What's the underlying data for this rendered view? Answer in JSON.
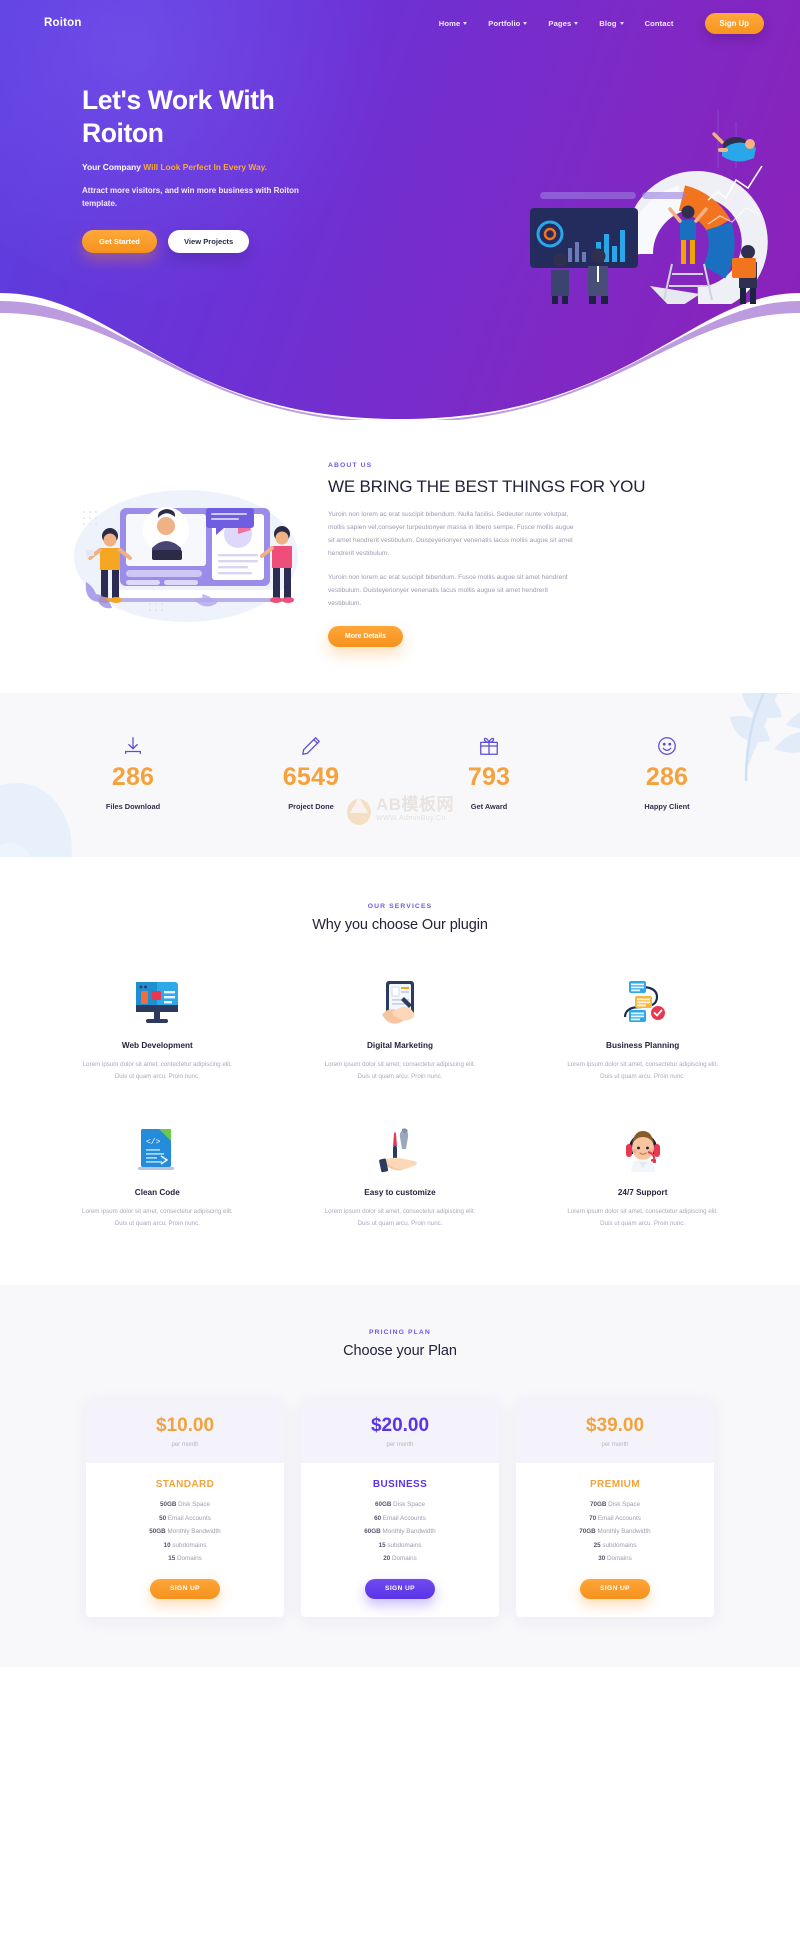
{
  "brand": "Roiton",
  "nav": {
    "items": [
      {
        "label": "Home",
        "caret": true
      },
      {
        "label": "Portfolio",
        "caret": true
      },
      {
        "label": "Pages",
        "caret": true
      },
      {
        "label": "Blog",
        "caret": true
      },
      {
        "label": "Contact",
        "caret": false
      }
    ],
    "signup_label": "Sign Up"
  },
  "hero": {
    "title_line1": "Let's Work With",
    "title_line2": "Roiton",
    "sub_white": "Your Company",
    "sub_accent": "Will Look Perfect In Every Way.",
    "description": "Attract more visitors, and win more business with Roiton template.",
    "btn_primary": "Get Started",
    "btn_secondary": "View Projects"
  },
  "about": {
    "eyebrow": "ABOUT US",
    "title": "WE BRING THE BEST THINGS FOR YOU",
    "paragraph1": "Yuroin non lorem ac erat suscipit bibendum. Nulla facilisi. Sedeuter nunte volutpat, mollis sapien vel,conseyer turpeutionyer massa in libero sempe. Fusce mollis augue sit amet hendrerit vestibulum. Duisteyerionyer venenatis lacus mollis augue sit amet hendrerit vestibulum.",
    "paragraph2": "Yuroin non lorem ac erat suscipit bibendum. Fusce mollis augue sit amet hendrent vestibulum. Duisteyerionyer venenatis lacus mollis augue sit amet hendrerit vestibulum.",
    "button": "More Details"
  },
  "counters": {
    "items": [
      {
        "icon": "download-icon",
        "value": "286",
        "label": "Files Download"
      },
      {
        "icon": "pencil-icon",
        "value": "6549",
        "label": "Project Done"
      },
      {
        "icon": "gift-icon",
        "value": "793",
        "label": "Get Award"
      },
      {
        "icon": "smile-icon",
        "value": "286",
        "label": "Happy Client"
      }
    ]
  },
  "watermark": {
    "main": "AB模板网",
    "sub": "WWW.AdminBuy.Cn"
  },
  "services": {
    "eyebrow": "OUR SERVICES",
    "title": "Why you choose Our plugin",
    "items": [
      {
        "icon": "monitor-icon",
        "name": "Web Development",
        "desc": "Lorem ipsum dolor sit amet, contectetur adipiscing elit. Duis ut quam arcu. Proin nunc."
      },
      {
        "icon": "tablet-hand-icon",
        "name": "Digital Marketing",
        "desc": "Lorem ipsum dolor sit amet, consectetur adipiscing elit. Duis ut quam arcu. Proin nunc."
      },
      {
        "icon": "flowchart-icon",
        "name": "Business Planning",
        "desc": "Lorem ipsum dolor sit amet, consectetur adipiscing elit. Duis ut quam arcu. Proin nunc."
      },
      {
        "icon": "code-file-icon",
        "name": "Clean Code",
        "desc": "Lorem ipsum dolor sit amet, consectetur adipiscing elit. Duis ut quam arcu. Proin nunc."
      },
      {
        "icon": "tools-hand-icon",
        "name": "Easy to customize",
        "desc": "Lorem ipsum dolor sit amet, consectetur adipiscing elit. Duis ut quam arcu. Proin nunc."
      },
      {
        "icon": "support-agent-icon",
        "name": "24/7 Support",
        "desc": "Lorem ipsum dolor sit amet, consectetur adipiscing elit. Duis ut quam arcu. Proin nunc."
      }
    ]
  },
  "pricing": {
    "eyebrow": "PRICING PLAN",
    "title": "Choose your Plan",
    "plans": [
      {
        "amount": "$10.00",
        "period": "per month",
        "name": "STANDARD",
        "accent": "#f2a33c",
        "button": "SIGN UP",
        "button_style": "orange",
        "features": [
          {
            "strong": "50GB",
            "text": " Disk Space"
          },
          {
            "strong": "50",
            "text": " Email Accounts"
          },
          {
            "strong": "50GB",
            "text": " Monthly Bandwidth"
          },
          {
            "strong": "10",
            "text": " subdomains"
          },
          {
            "strong": "15",
            "text": " Domains"
          }
        ]
      },
      {
        "amount": "$20.00",
        "period": "per month",
        "name": "BUSINESS",
        "accent": "#5a33e6",
        "button": "SIGN UP",
        "button_style": "purple",
        "features": [
          {
            "strong": "60GB",
            "text": " Disk Space"
          },
          {
            "strong": "60",
            "text": " Email Accounts"
          },
          {
            "strong": "60GB",
            "text": " Monthly Bandwidth"
          },
          {
            "strong": "15",
            "text": " subdomains"
          },
          {
            "strong": "20",
            "text": " Domains"
          }
        ]
      },
      {
        "amount": "$39.00",
        "period": "per month",
        "name": "PREMIUM",
        "accent": "#f2a33c",
        "button": "SIGN UP",
        "button_style": "orange",
        "features": [
          {
            "strong": "70GB",
            "text": " Disk Space"
          },
          {
            "strong": "70",
            "text": " Email Accounts"
          },
          {
            "strong": "70GB",
            "text": " Monthly Bandwidth"
          },
          {
            "strong": "25",
            "text": " subdomains"
          },
          {
            "strong": "30",
            "text": " Domains"
          }
        ]
      }
    ]
  },
  "colors": {
    "hero_gradient_start": "#5b3fe0",
    "hero_gradient_end": "#8d21b8",
    "accent_orange": "#f5921c",
    "accent_purple": "#5a33e6",
    "counter_number": "#f6a23c",
    "muted_text": "#9a9ab0"
  }
}
